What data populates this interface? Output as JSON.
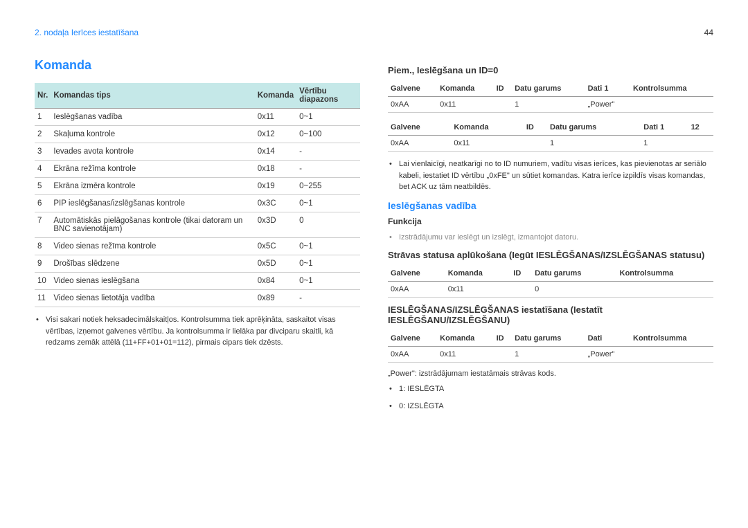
{
  "chapter_label": "2. nodaļa Ierīces iestatīšana",
  "page_number": "44",
  "left": {
    "title": "Komanda",
    "table_headers": [
      "Nr.",
      "Komandas tips",
      "Komanda",
      "Vērtību diapazons"
    ],
    "rows": [
      [
        "1",
        "Ieslēgšanas vadība",
        "0x11",
        "0~1"
      ],
      [
        "2",
        "Skaļuma kontrole",
        "0x12",
        "0~100"
      ],
      [
        "3",
        "Ievades avota kontrole",
        "0x14",
        "-"
      ],
      [
        "4",
        "Ekrāna režīma kontrole",
        "0x18",
        "-"
      ],
      [
        "5",
        "Ekrāna izmēra kontrole",
        "0x19",
        "0~255"
      ],
      [
        "6",
        "PIP ieslēgšanas/izslēgšanas kontrole",
        "0x3C",
        "0~1"
      ],
      [
        "7",
        "Automātiskās pielāgošanas kontrole (tikai datoram un BNC savienotājam)",
        "0x3D",
        "0"
      ],
      [
        "8",
        "Video sienas režīma kontrole",
        "0x5C",
        "0~1"
      ],
      [
        "9",
        "Drošības slēdzene",
        "0x5D",
        "0~1"
      ],
      [
        "10",
        "Video sienas ieslēgšana",
        "0x84",
        "0~1"
      ],
      [
        "11",
        "Video sienas lietotāja vadība",
        "0x89",
        "-"
      ]
    ],
    "note": "Visi sakari notiek heksadecimālskaitļos. Kontrolsumma tiek aprēķināta, saskaitot visas vērtības, izņemot galvenes vērtību. Ja kontrolsumma ir lielāka par divciparu skaitli, kā redzams zemāk attēlā (11+FF+01+01=112), pirmais cipars tiek dzēsts."
  },
  "right": {
    "example_title": "Piem., Ieslēgšana un ID=0",
    "t1_headers": [
      "Galvene",
      "Komanda",
      "ID",
      "Datu garums",
      "Dati 1",
      "Kontrolsumma"
    ],
    "t1_rows": [
      [
        "0xAA",
        "0x11",
        "",
        "1",
        "„Power\"",
        ""
      ]
    ],
    "t2_headers": [
      "Galvene",
      "Komanda",
      "ID",
      "Datu garums",
      "Dati 1",
      "12"
    ],
    "t2_rows": [
      [
        "0xAA",
        "0x11",
        "",
        "1",
        "1",
        ""
      ]
    ],
    "note1": "Lai vienlaicīgi, neatkarīgi no to ID numuriem, vadītu visas ierīces, kas pievienotas ar seriālo kabeli, iestatiet ID vērtību „0xFE\" un sūtiet komandas. Katra ierīce izpildīs visas komandas, bet ACK uz tām neatbildēs.",
    "section2": "Ieslēgšanas vadība",
    "s2_func": "Funkcija",
    "s2_func_text": "Izstrādājumu var ieslēgt un izslēgt, izmantojot datoru.",
    "s2_h1": "Strāvas statusa aplūkošana (Iegūt IESLĒGŠANAS/IZSLĒGŠANAS statusu)",
    "t3_headers": [
      "Galvene",
      "Komanda",
      "ID",
      "Datu garums",
      "Kontrolsumma"
    ],
    "t3_rows": [
      [
        "0xAA",
        "0x11",
        "",
        "0",
        ""
      ]
    ],
    "s2_h2": "IESLĒGŠANAS/IZSLĒGŠANAS iestatīšana (Iestatīt IESLĒGŠANU/IZSLĒGŠANU)",
    "t4_headers": [
      "Galvene",
      "Komanda",
      "ID",
      "Datu garums",
      "Dati",
      "Kontrolsumma"
    ],
    "t4_rows": [
      [
        "0xAA",
        "0x11",
        "",
        "1",
        "„Power\"",
        ""
      ]
    ],
    "power_note": "„Power\": izstrādājumam iestatāmais strāvas kods.",
    "pw1": "1: IESLĒGTA",
    "pw0": "0: IZSLĒGTA"
  }
}
